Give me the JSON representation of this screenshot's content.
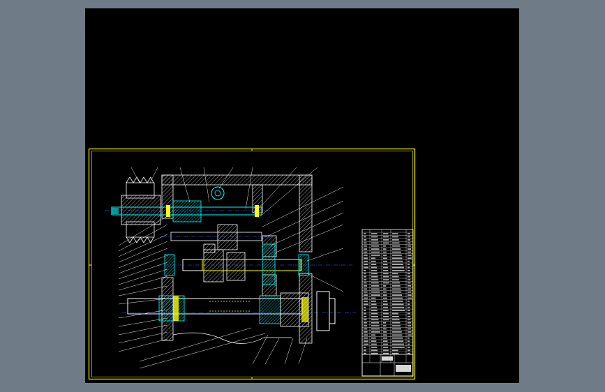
{
  "colors": {
    "window_bg": "#6f7c88",
    "canvas": "#000000",
    "frame": "#ffff00",
    "outline": "#ffffff",
    "cyan": "#00ffff",
    "hatch": "#c8c8c8",
    "center_line": "#3b6bff",
    "leader": "#e8e8e8"
  },
  "icons": [
    "gear-pulley-icon",
    "bearing-icon",
    "shaft-icon"
  ],
  "views": [
    "gearbox-section-view",
    "parts-list-table",
    "title-block"
  ]
}
